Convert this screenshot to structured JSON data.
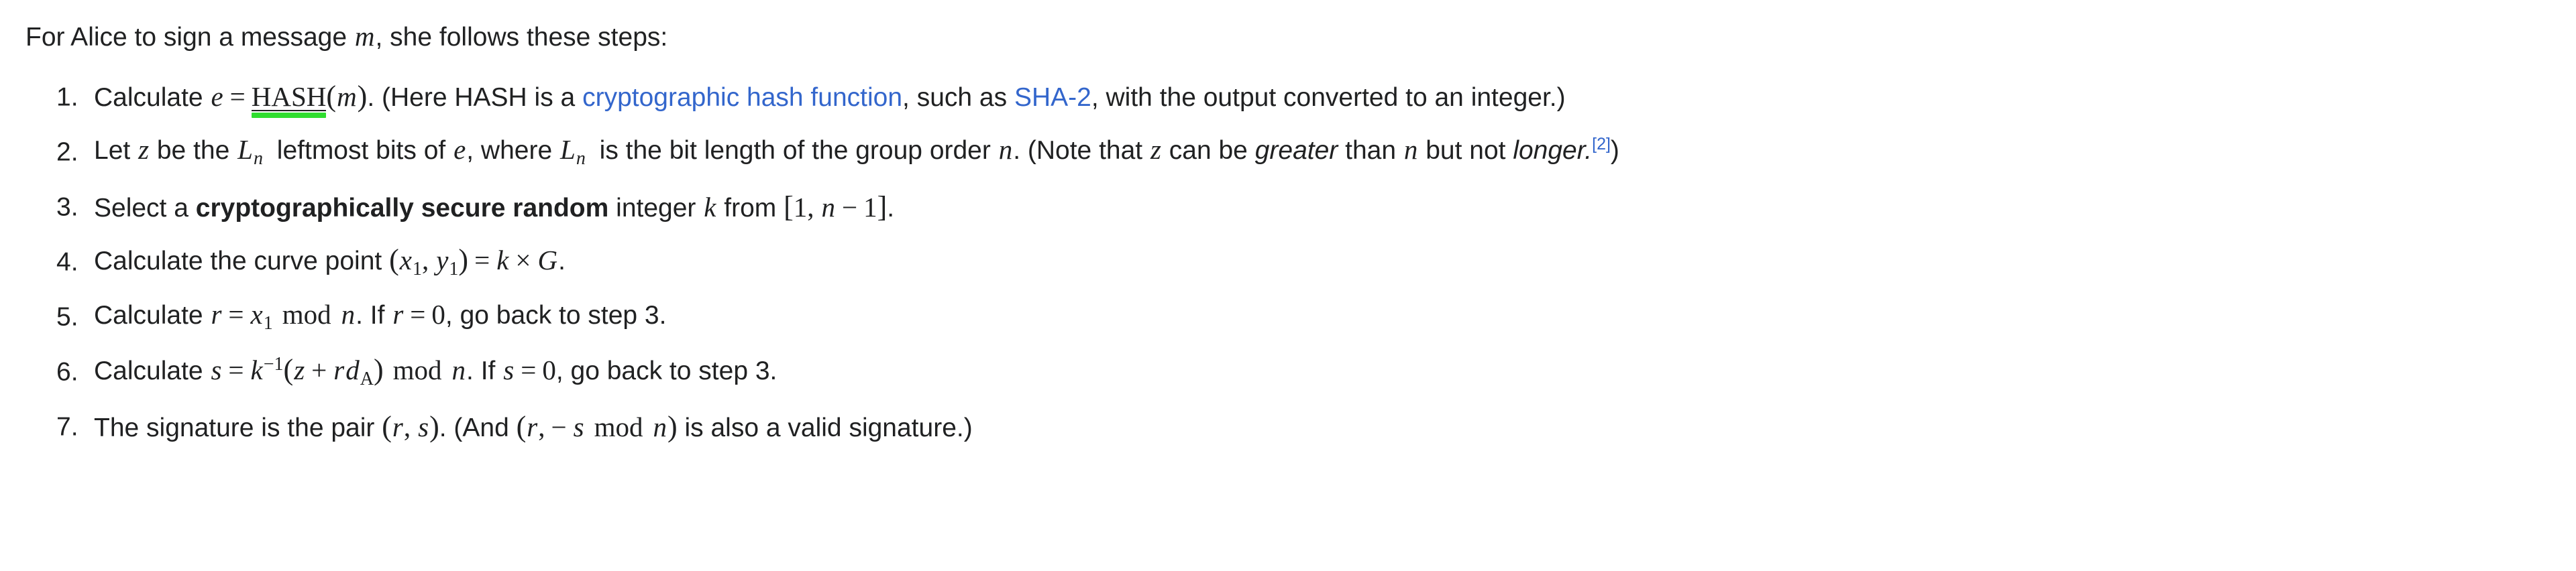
{
  "document": {
    "intro": {
      "before_var": "For Alice to sign a message ",
      "variable": "m",
      "after_var": ", she follows these steps:"
    },
    "colors": {
      "text": "#202122",
      "link": "#3366cc",
      "highlight_green": "#2fdd2f",
      "background": "#ffffff"
    },
    "steps": [
      {
        "number": "1.",
        "t1": "Calculate ",
        "var_e": "e",
        "eq": "=",
        "hash_label": "HASH",
        "paren_open": "(",
        "var_m": "m",
        "paren_close": ")",
        "t2": ". (Here HASH is a ",
        "link1": "cryptographic hash function",
        "t3": ", such as ",
        "link2": "SHA-2",
        "t4": ", with the output converted to an integer.)"
      },
      {
        "number": "2.",
        "t1": "Let ",
        "var_z": "z",
        "t2": " be the ",
        "var_L": "L",
        "sub_n1": "n",
        "t3": " leftmost bits of ",
        "var_e": "e",
        "t4": ", where ",
        "var_L2": "L",
        "sub_n2": "n",
        "t5": " is the bit length of the group order ",
        "var_n": "n",
        "t6": ". (Note that ",
        "var_z2": "z",
        "t7": " can be ",
        "em_greater": "greater",
        "t8": " than ",
        "var_n2": "n",
        "t9": " but not ",
        "em_longer": "longer.",
        "citation": "[2]",
        "t10": ")"
      },
      {
        "number": "3.",
        "t1": "Select a ",
        "bold": "cryptographically secure random",
        "t2": " integer ",
        "var_k": "k",
        "t3": " from ",
        "bracket_open": "[",
        "one": "1",
        "comma": ",",
        "var_n": "n",
        "minus": "−",
        "one2": "1",
        "bracket_close": "]",
        "t4": "."
      },
      {
        "number": "4.",
        "t1": "Calculate the curve point ",
        "paren_open": "(",
        "var_x": "x",
        "sub_x": "1",
        "comma": ",",
        "var_y": "y",
        "sub_y": "1",
        "paren_close": ")",
        "eq": "=",
        "var_k": "k",
        "times": "×",
        "var_G": "G",
        "t2": "."
      },
      {
        "number": "5.",
        "t1": "Calculate ",
        "var_r": "r",
        "eq": "=",
        "var_x": "x",
        "sub_x": "1",
        "mod": "mod",
        "var_n": "n",
        "t2": ". If ",
        "var_r2": "r",
        "eq2": "=",
        "zero": "0",
        "t3": ", go back to step 3."
      },
      {
        "number": "6.",
        "t1": "Calculate ",
        "var_s": "s",
        "eq": "=",
        "var_k": "k",
        "sup_inv": "−1",
        "paren_open": "(",
        "var_z": "z",
        "plus": "+",
        "var_r": "r",
        "var_d": "d",
        "sub_A": "A",
        "paren_close": ")",
        "mod": "mod",
        "var_n": "n",
        "t2": ". If ",
        "var_s2": "s",
        "eq2": "=",
        "zero": "0",
        "t3": ", go back to step 3."
      },
      {
        "number": "7.",
        "t1": "The signature is the pair ",
        "paren_open": "(",
        "var_r": "r",
        "comma": ",",
        "var_s": "s",
        "paren_close": ")",
        "t2": ". (And ",
        "paren_open2": "(",
        "var_r2": "r",
        "comma2": ",",
        "minus": "−",
        "var_s2": "s",
        "mod": "mod",
        "var_n": "n",
        "paren_close2": ")",
        "t3": " is also a valid signature.)"
      }
    ]
  }
}
